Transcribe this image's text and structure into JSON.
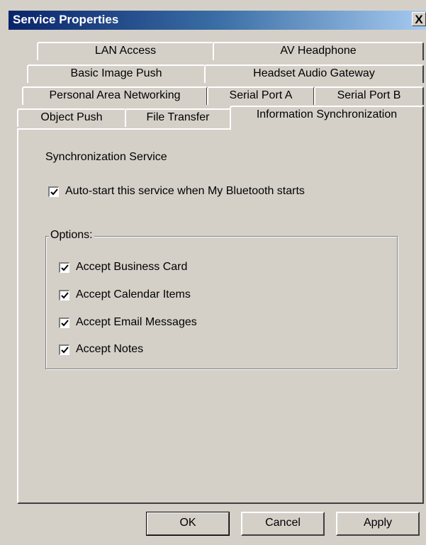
{
  "window": {
    "title": "Service Properties",
    "close_glyph": "X"
  },
  "tabs": {
    "row1": [
      "LAN Access",
      "AV Headphone"
    ],
    "row2": [
      "Basic Image Push",
      "Headset Audio Gateway"
    ],
    "row3": [
      "Personal Area Networking",
      "Serial Port A",
      "Serial Port B"
    ],
    "row4": [
      "Object Push",
      "File Transfer",
      "Information Synchronization"
    ],
    "active": "Information Synchronization"
  },
  "panel": {
    "heading": "Synchronization Service",
    "autostart": {
      "label": "Auto-start this service when My Bluetooth starts",
      "checked": true
    },
    "options": {
      "title": "Options:",
      "items": [
        {
          "label": "Accept Business Card",
          "checked": true
        },
        {
          "label": "Accept Calendar Items",
          "checked": true
        },
        {
          "label": "Accept Email Messages",
          "checked": true
        },
        {
          "label": "Accept Notes",
          "checked": true
        }
      ]
    }
  },
  "buttons": {
    "ok": "OK",
    "cancel": "Cancel",
    "apply": "Apply"
  }
}
